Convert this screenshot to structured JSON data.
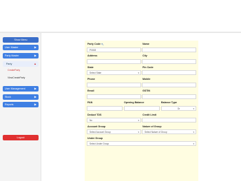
{
  "sidebar": {
    "header": "Show Menu",
    "items": [
      {
        "label": "User Master"
      },
      {
        "label": "Party Master"
      }
    ],
    "party": {
      "label": "Party"
    },
    "sub_items": [
      {
        "label": "CreateParty"
      },
      {
        "label": "ViewCreateParty"
      }
    ],
    "items2": [
      {
        "label": "User Management"
      },
      {
        "label": "Stock"
      },
      {
        "label": "Reports"
      }
    ],
    "logout": "Logout"
  },
  "form": {
    "party_code": {
      "label": "Party Code",
      "value": "P0008"
    },
    "name": {
      "label": "Name",
      "value": ""
    },
    "address": {
      "label": "Address",
      "value": ""
    },
    "city": {
      "label": "City",
      "value": ""
    },
    "state": {
      "label": "State",
      "value": "Select State"
    },
    "pin_code": {
      "label": "Pin Code",
      "value": ""
    },
    "phone": {
      "label": "Phone",
      "value": ""
    },
    "mobile": {
      "label": "Mobile",
      "value": ""
    },
    "email": {
      "label": "Email",
      "value": ""
    },
    "gstin": {
      "label": "GSTIN",
      "value": ""
    },
    "pan": {
      "label": "PAN",
      "value": ""
    },
    "opening_balance": {
      "label": "Opening Balance",
      "value": ""
    },
    "balance_type": {
      "label": "Balance Type",
      "value": "Dr"
    },
    "deduct_tds": {
      "label": "Deduct TDS",
      "value": "No"
    },
    "credit_limit": {
      "label": "Credit Limit",
      "value": ""
    },
    "account_group": {
      "label": "Account Group",
      "value": "Select Account Group"
    },
    "nature_of_group": {
      "label": "Nature of Group",
      "value": "Select Nature of Group"
    },
    "under_group": {
      "label": "Under Group",
      "value": "Select Under Group"
    }
  },
  "icons": {
    "arrow": "chevron-right-icon",
    "arrow_open": "chevron-up-icon",
    "caret": "caret-down-icon"
  }
}
